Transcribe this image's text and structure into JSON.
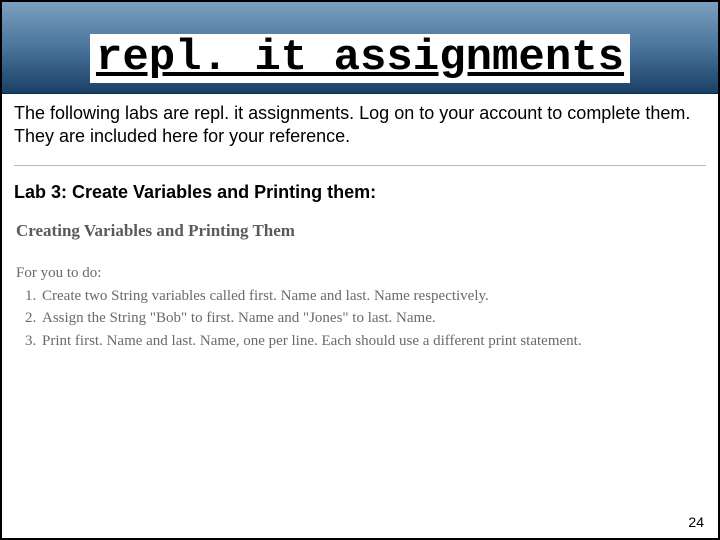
{
  "header": {
    "title": "repl. it assignments"
  },
  "intro": "The following labs are repl. it assignments. Log on to your account to complete them. They are included here for your reference.",
  "lab": {
    "title": "Lab 3: Create Variables and Printing them:",
    "embedded": {
      "heading": "Creating Variables and Printing Them",
      "lead": "For you to do:",
      "steps": [
        "Create two String variables called first. Name and last. Name respectively.",
        "Assign the String \"Bob\" to first. Name and \"Jones\" to last. Name.",
        "Print first. Name and last. Name, one per line.  Each should use a different print statement."
      ]
    }
  },
  "page_number": "24"
}
